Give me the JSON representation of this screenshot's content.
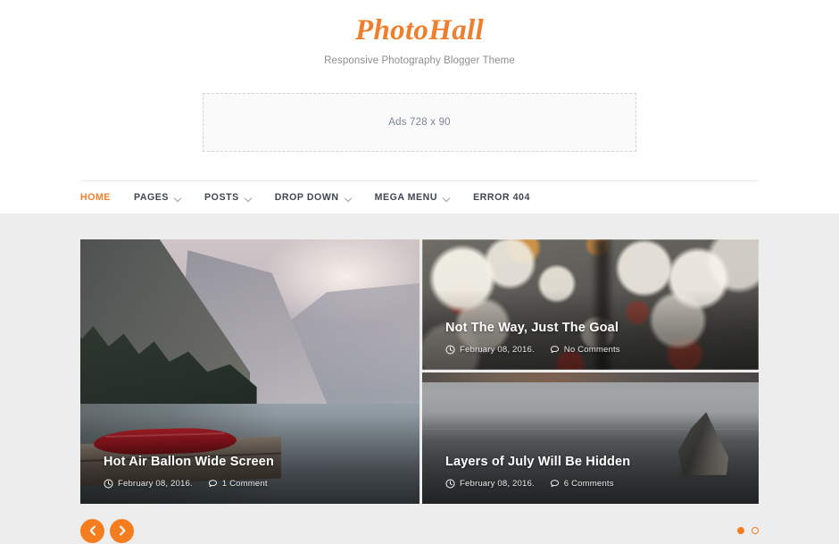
{
  "site": {
    "logo": "PhotoHall",
    "tagline": "Responsive Photography Blogger Theme",
    "accent_color": "#ef7f2e",
    "page_background": "#ededed"
  },
  "ads": {
    "label": "Ads 728 x 90"
  },
  "nav": {
    "items": [
      {
        "label": "HOME",
        "has_dropdown": false,
        "active": true
      },
      {
        "label": "PAGES",
        "has_dropdown": true,
        "active": false
      },
      {
        "label": "POSTS",
        "has_dropdown": true,
        "active": false
      },
      {
        "label": "DROP DOWN",
        "has_dropdown": true,
        "active": false
      },
      {
        "label": "MEGA MENU",
        "has_dropdown": true,
        "active": false
      },
      {
        "label": "ERROR 404",
        "has_dropdown": false,
        "active": false
      }
    ]
  },
  "slider": {
    "posts": [
      {
        "title": "Hot Air Ballon Wide Screen",
        "date": "February 08, 2016.",
        "comments": "1 Comment",
        "date_icon": "clock-icon",
        "comment_icon": "comment-bubble-icon",
        "image_alt": "Red canoe on wooden dock at misty mountain lake"
      },
      {
        "title": "Not The Way, Just The Goal",
        "date": "February 08, 2016.",
        "comments": "No Comments",
        "date_icon": "clock-icon",
        "comment_icon": "comment-bubble-icon",
        "image_alt": "Blurred bokeh of autumn leaves and light circles"
      },
      {
        "title": "Layers of July Will Be Hidden",
        "date": "February 08, 2016.",
        "comments": "6 Comments",
        "date_icon": "clock-icon",
        "comment_icon": "comment-bubble-icon",
        "image_alt": "Grey seascape with rocky sea stack on the horizon"
      }
    ],
    "controls": {
      "prev_icon": "chevron-left-icon",
      "next_icon": "chevron-right-icon",
      "dots": [
        {
          "active": true
        },
        {
          "active": false
        }
      ]
    }
  }
}
